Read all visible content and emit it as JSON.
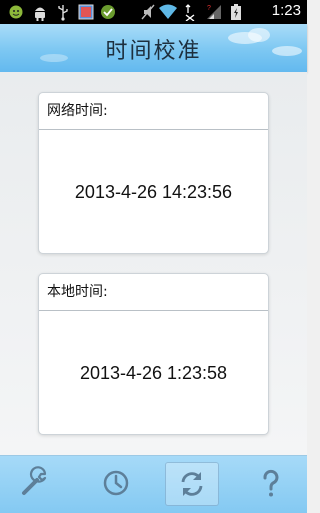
{
  "status_bar": {
    "time": "1:23",
    "icons": [
      "smiley-app-icon",
      "android-icon",
      "usb-icon",
      "gallery-icon",
      "app-icon",
      "mute-icon",
      "wifi-icon",
      "network-activity-icon",
      "signal-icon",
      "battery-charging-icon"
    ]
  },
  "header": {
    "title": "时间校准"
  },
  "network_card": {
    "label": "网络时间:",
    "value": "2013-4-26 14:23:56"
  },
  "local_card": {
    "label": "本地时间:",
    "value": "2013-4-26 1:23:58"
  },
  "bottom_nav": {
    "items": [
      {
        "icon": "wrench-icon",
        "active": false
      },
      {
        "icon": "clock-icon",
        "active": false
      },
      {
        "icon": "sync-icon",
        "active": true
      },
      {
        "icon": "help-icon",
        "active": false
      }
    ]
  },
  "colors": {
    "accent": "#7cc7f2",
    "status_bar": "#000000"
  }
}
